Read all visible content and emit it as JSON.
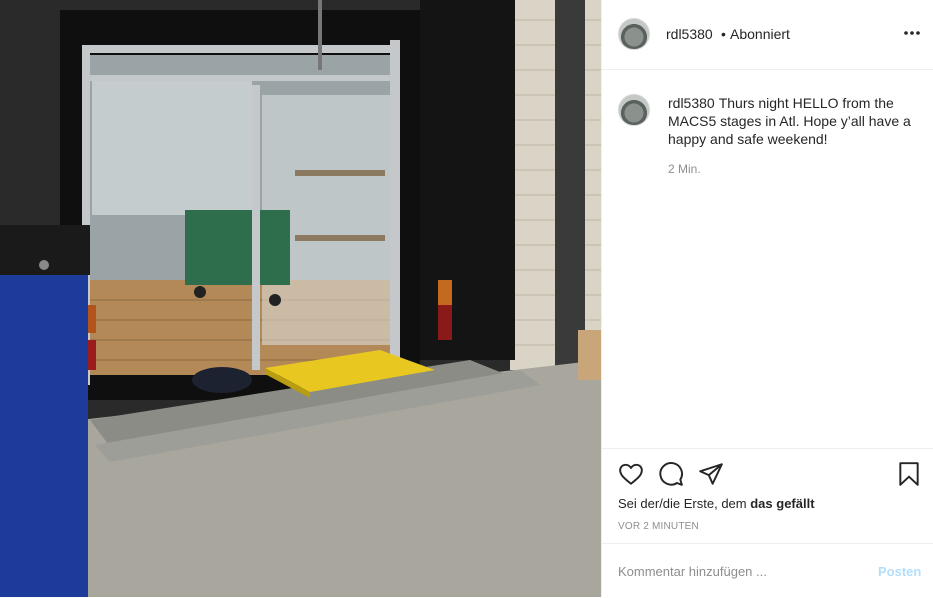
{
  "header": {
    "username": "rdl5380",
    "separator": "•",
    "follow_status": "Abonniert"
  },
  "caption": {
    "username": "rdl5380",
    "text": "Thurs night HELLO from the MACS5 stages in Atl. Hope y’all have a happy and safe weekend!",
    "time": "2 Min."
  },
  "actions": {
    "likes_prefix": "Sei der/die Erste, dem ",
    "likes_bold": "das gefällt",
    "time_ago": "VOR 2 MINUTEN"
  },
  "comment": {
    "placeholder": "Kommentar hinzufügen ...",
    "post_label": "Posten"
  },
  "icons": [
    "more-options-icon",
    "heart-icon",
    "comment-icon",
    "share-icon",
    "bookmark-icon"
  ],
  "colors": {
    "text": "#262626",
    "muted": "#8e8e8e",
    "post_button_disabled": "#b2dffc",
    "divider": "#efefef"
  }
}
